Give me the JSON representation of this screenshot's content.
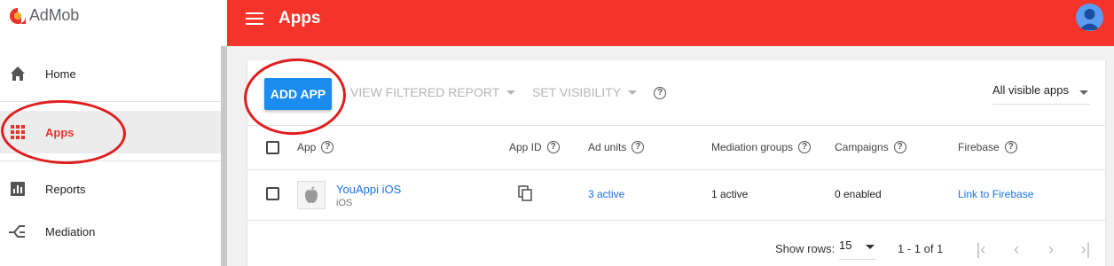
{
  "brand": {
    "name": "AdMob",
    "logo_icon": "admob-logo-icon"
  },
  "sidebar": {
    "items": [
      {
        "label": "Home",
        "icon": "home-icon"
      },
      {
        "label": "Apps",
        "icon": "apps-grid-icon",
        "active": true
      },
      {
        "label": "Reports",
        "icon": "reports-icon"
      },
      {
        "label": "Mediation",
        "icon": "mediation-icon"
      }
    ]
  },
  "header": {
    "title": "Apps",
    "accent": "#f4342a"
  },
  "toolbar": {
    "add_app": "ADD APP",
    "view_filtered_report": "VIEW FILTERED REPORT",
    "set_visibility": "SET VISIBILITY",
    "visibility_select": "All visible apps",
    "primary_color": "#1a8cf0"
  },
  "table": {
    "columns": [
      "App",
      "App ID",
      "Ad units",
      "Mediation groups",
      "Campaigns",
      "Firebase"
    ],
    "rows": [
      {
        "app_name": "YouAppi iOS",
        "platform": "iOS",
        "ad_units": "3 active",
        "mediation_groups": "1 active",
        "campaigns": "0 enabled",
        "firebase": "Link to Firebase"
      }
    ]
  },
  "pagination": {
    "show_rows_label": "Show rows:",
    "rows_per_page": "15",
    "range": "1 - 1 of 1"
  }
}
